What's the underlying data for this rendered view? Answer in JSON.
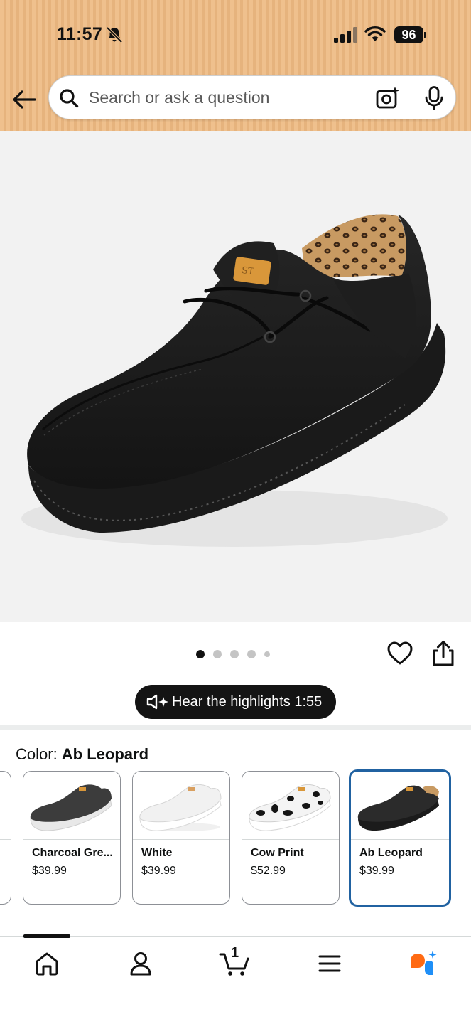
{
  "status_bar": {
    "time": "11:57",
    "battery": "96",
    "bell_icon": "bell-slash-icon",
    "signal_icon": "signal-icon",
    "wifi_icon": "wifi-icon"
  },
  "header": {
    "back_icon": "arrow-left-icon",
    "search": {
      "placeholder": "Search or ask a question",
      "value": ""
    },
    "search_icon": "search-icon",
    "camera_icon": "camera-sparkle-icon",
    "mic_icon": "mic-icon",
    "background_color": "#efc08d"
  },
  "product": {
    "image_icon": "black-canvas-shoe-leopard-lining",
    "carousel": {
      "pages": 5,
      "active_index": 0
    },
    "wishlist_icon": "heart-icon",
    "share_icon": "share-icon"
  },
  "audio_summary": {
    "label": "Hear the highlights 1:55",
    "icon": "speaker-sparkle-icon"
  },
  "color_selector": {
    "label": "Color: ",
    "selected": "Ab Leopard",
    "selected_border_color": "#2162a1",
    "options": [
      {
        "name": "Charcoal Gre...",
        "price": "$39.99",
        "shoe_color": "#3c3c3c",
        "sole_color": "#e8e8e8"
      },
      {
        "name": "White",
        "price": "$39.99",
        "shoe_color": "#f1f1f1",
        "sole_color": "#ffffff"
      },
      {
        "name": "Cow Print",
        "price": "$52.99",
        "shoe_color": "#f4f4f4",
        "sole_color": "#ffffff"
      },
      {
        "name": "Ab Leopard",
        "price": "$39.99",
        "shoe_color": "#2b2b2b",
        "sole_color": "#1b1b1b"
      }
    ]
  },
  "bottom_nav": {
    "items": [
      {
        "name": "home",
        "icon": "home-icon"
      },
      {
        "name": "account",
        "icon": "person-icon"
      },
      {
        "name": "cart",
        "icon": "cart-icon",
        "count": "1"
      },
      {
        "name": "menu",
        "icon": "hamburger-menu-icon"
      },
      {
        "name": "rufus",
        "icon": "rufus-assistant-icon"
      }
    ],
    "accent_colors": [
      "#ff6a13",
      "#1f8ff7"
    ]
  }
}
